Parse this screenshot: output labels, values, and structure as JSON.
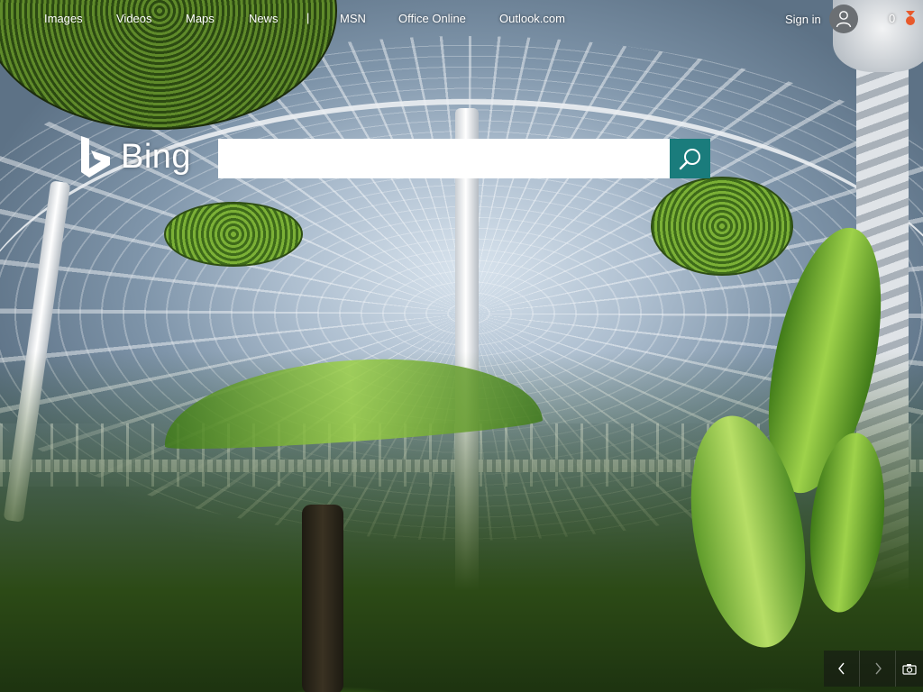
{
  "nav": {
    "links": [
      {
        "label": "Images"
      },
      {
        "label": "Videos"
      },
      {
        "label": "Maps"
      },
      {
        "label": "News"
      },
      {
        "label": "MSN"
      },
      {
        "label": "Office Online"
      },
      {
        "label": "Outlook.com"
      }
    ],
    "separator": "|",
    "sign_in": "Sign in",
    "rewards_count": "0"
  },
  "brand": {
    "name": "Bing",
    "color": "#ffffff"
  },
  "search": {
    "value": "",
    "placeholder": "",
    "button_color": "#1a7c7c",
    "button_icon": "search-icon"
  },
  "controls": {
    "prev_icon": "chevron-left-icon",
    "next_icon": "chevron-right-icon",
    "camera_icon": "camera-icon"
  },
  "colors": {
    "accent": "#1a7c7c",
    "rewards": "#e8592b"
  }
}
